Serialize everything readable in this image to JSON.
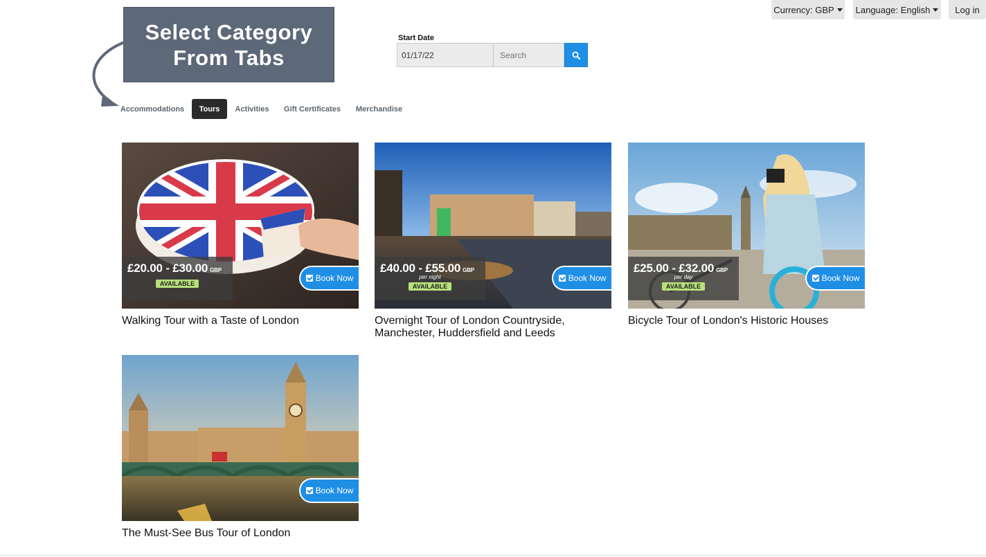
{
  "header": {
    "currency_label": "Currency: GBP",
    "language_label": "Language: English",
    "login_label": "Log in"
  },
  "callout": {
    "line1": "Select Category",
    "line2": "From Tabs"
  },
  "search": {
    "start_date_label": "Start Date",
    "start_date_value": "01/17/22",
    "search_placeholder": "Search"
  },
  "tabs": [
    {
      "label": "Accommodations",
      "active": false
    },
    {
      "label": "Tours",
      "active": true
    },
    {
      "label": "Activities",
      "active": false
    },
    {
      "label": "Gift Certificates",
      "active": false
    },
    {
      "label": "Merchandise",
      "active": false
    }
  ],
  "cards": [
    {
      "title": "Walking Tour with a Taste of London",
      "price": "£20.00 - £30.00",
      "currency": "GBP",
      "unit": "",
      "status": "AVAILABLE",
      "button": "Book Now"
    },
    {
      "title": "Overnight Tour of London Countryside, Manchester, Huddersfield and Leeds",
      "price": "£40.00 - £55.00",
      "currency": "GBP",
      "unit": "per night",
      "status": "AVAILABLE",
      "button": "Book Now"
    },
    {
      "title": "Bicycle Tour of London's Historic Houses",
      "price": "£25.00 - £32.00",
      "currency": "GBP",
      "unit": "per day",
      "status": "AVAILABLE",
      "button": "Book Now"
    },
    {
      "title": "The Must-See Bus Tour of London",
      "button": "Book Now"
    }
  ],
  "colors": {
    "accent": "#1f8fe5",
    "active_tab": "#2b2b2b",
    "available_badge": "#b7e07a",
    "callout_bg": "#5d6878"
  }
}
